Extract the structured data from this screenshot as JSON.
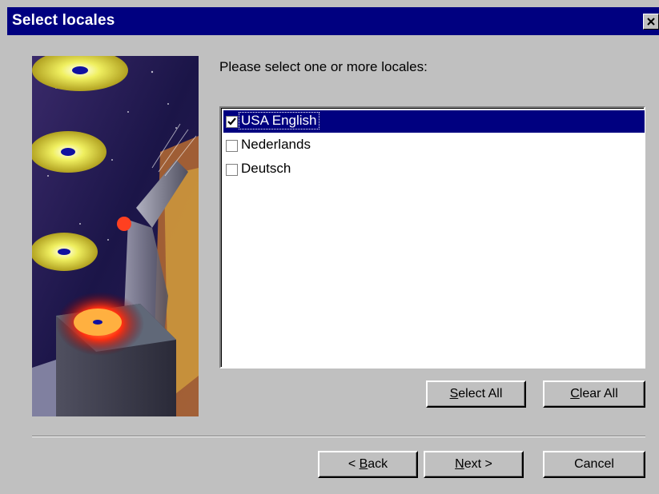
{
  "window": {
    "title": "Select locales",
    "close_glyph": "✕"
  },
  "main": {
    "prompt": "Please select one or more locales:",
    "locales": [
      {
        "label": "USA English",
        "checked": true,
        "selected": true
      },
      {
        "label": "Nederlands",
        "checked": false,
        "selected": false
      },
      {
        "label": "Deutsch",
        "checked": false,
        "selected": false
      }
    ],
    "select_all_label": {
      "mnemonic": "S",
      "rest": "elect All"
    },
    "clear_all_label": {
      "mnemonic": "C",
      "rest": "lear All"
    }
  },
  "footer": {
    "back_label": {
      "prefix": "< ",
      "mnemonic": "B",
      "rest": "ack"
    },
    "next_label": {
      "mnemonic": "N",
      "rest": "ext >"
    },
    "cancel_label": "Cancel"
  },
  "colors": {
    "titlebar": "#000080",
    "dialog_bg": "#c0c0c0",
    "selection": "#000080"
  }
}
